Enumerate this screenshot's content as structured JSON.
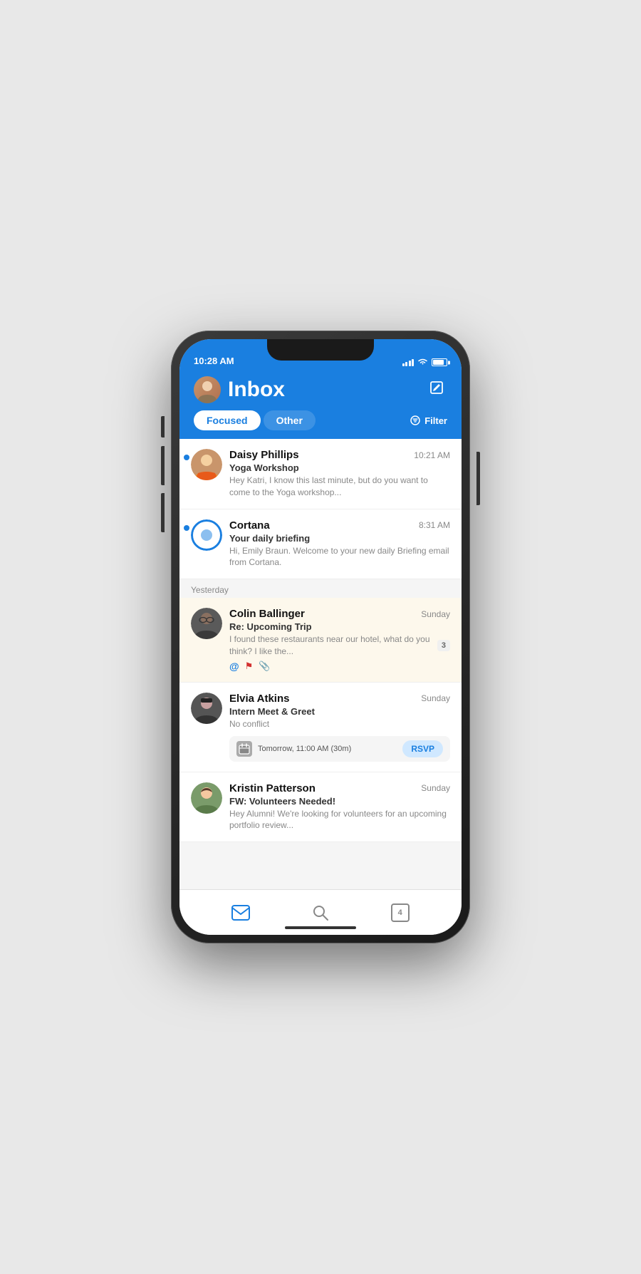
{
  "device": {
    "time": "10:28 AM"
  },
  "header": {
    "title": "Inbox",
    "compose_label": "✏",
    "tab_focused": "Focused",
    "tab_other": "Other",
    "filter_label": "Filter"
  },
  "sections": [
    {
      "label": "",
      "emails": [
        {
          "id": "daisy",
          "sender": "Daisy Phillips",
          "time": "10:21 AM",
          "subject": "Yoga Workshop",
          "preview": "Hey Katri, I know this last minute, but do you want to come to the Yoga workshop...",
          "unread": true,
          "highlighted": false
        },
        {
          "id": "cortana",
          "sender": "Cortana",
          "time": "8:31 AM",
          "subject": "Your daily briefing",
          "preview": "Hi, Emily Braun. Welcome to your new daily Briefing email from Cortana.",
          "unread": true,
          "highlighted": false
        }
      ]
    },
    {
      "label": "Yesterday",
      "emails": [
        {
          "id": "colin",
          "sender": "Colin Ballinger",
          "time": "Sunday",
          "subject": "Re: Upcoming Trip",
          "preview": "I found these restaurants near our hotel, what do you think? I like the...",
          "unread": false,
          "highlighted": true,
          "has_at": true,
          "has_flag": true,
          "has_attach": true,
          "thread_count": "3"
        },
        {
          "id": "elvia",
          "sender": "Elvia Atkins",
          "time": "Sunday",
          "subject": "Intern Meet & Greet",
          "preview": "No conflict",
          "unread": false,
          "highlighted": false,
          "has_rsvp": true,
          "rsvp_time": "Tomorrow, 11:00 AM (30m)",
          "rsvp_label": "RSVP"
        },
        {
          "id": "kristin",
          "sender": "Kristin Patterson",
          "time": "Sunday",
          "subject": "FW: Volunteers Needed!",
          "preview": "Hey Alumni! We're looking for volunteers for an upcoming portfolio review...",
          "unread": false,
          "highlighted": false
        }
      ]
    }
  ],
  "bottom_nav": {
    "mail_label": "✉",
    "search_label": "○",
    "calendar_num": "4"
  }
}
